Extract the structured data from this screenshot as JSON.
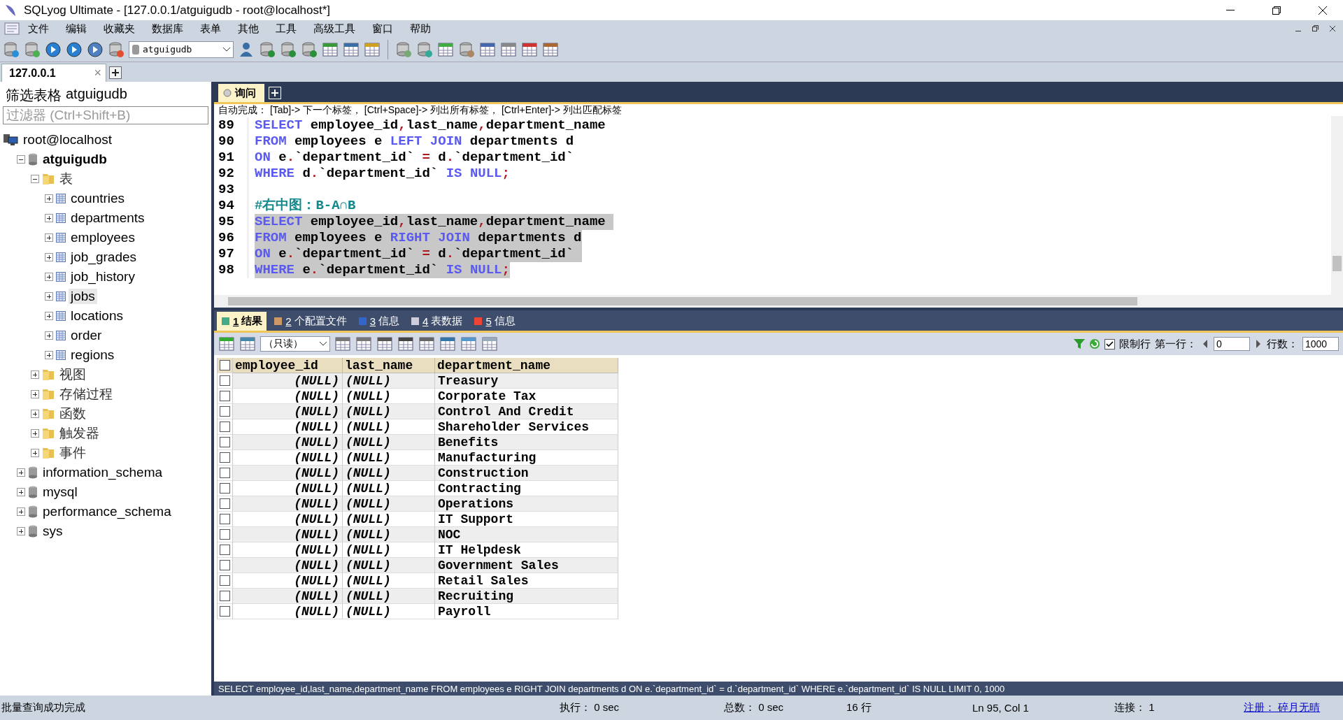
{
  "window": {
    "title": "SQLyog Ultimate - [127.0.0.1/atguigudb - root@localhost*]"
  },
  "menu": [
    "文件",
    "编辑",
    "收藏夹",
    "数据库",
    "表单",
    "其他",
    "工具",
    "高级工具",
    "窗口",
    "帮助"
  ],
  "toolbar": {
    "database_select": "atguigudb"
  },
  "connection_tabs": [
    {
      "label": "127.0.0.1",
      "selected": true,
      "close": "×"
    }
  ],
  "sidebar": {
    "title_prefix": "筛选表格",
    "title_db": "atguigudb",
    "filter": {
      "placeholder": "过滤器 (Ctrl+Shift+B)"
    },
    "tree": [
      {
        "label": "root@localhost",
        "kind": "server",
        "selected": false,
        "children": [
          {
            "label": "atguigudb",
            "kind": "database",
            "bold": true,
            "expanded": true,
            "selected": false,
            "children": [
              {
                "label": "表",
                "kind": "folder",
                "expanded": true,
                "selected": false,
                "children": [
                  {
                    "label": "countries",
                    "kind": "table",
                    "expanded": false,
                    "selected": false
                  },
                  {
                    "label": "departments",
                    "kind": "table",
                    "expanded": false,
                    "selected": false
                  },
                  {
                    "label": "employees",
                    "kind": "table",
                    "expanded": false,
                    "selected": false
                  },
                  {
                    "label": "job_grades",
                    "kind": "table",
                    "expanded": false,
                    "selected": false
                  },
                  {
                    "label": "job_history",
                    "kind": "table",
                    "expanded": false,
                    "selected": false
                  },
                  {
                    "label": "jobs",
                    "kind": "table",
                    "expanded": false,
                    "selected": true
                  },
                  {
                    "label": "locations",
                    "kind": "table",
                    "expanded": false,
                    "selected": false
                  },
                  {
                    "label": "order",
                    "kind": "table",
                    "expanded": false,
                    "selected": false
                  },
                  {
                    "label": "regions",
                    "kind": "table",
                    "expanded": false,
                    "selected": false
                  }
                ]
              },
              {
                "label": "视图",
                "kind": "folder",
                "expanded": false,
                "selected": false
              },
              {
                "label": "存储过程",
                "kind": "folder",
                "expanded": false,
                "selected": false
              },
              {
                "label": "函数",
                "kind": "folder",
                "expanded": false,
                "selected": false
              },
              {
                "label": "触发器",
                "kind": "folder",
                "expanded": false,
                "selected": false
              },
              {
                "label": "事件",
                "kind": "folder",
                "expanded": false,
                "selected": false
              }
            ]
          },
          {
            "label": "information_schema",
            "kind": "database",
            "expanded": false,
            "selected": false
          },
          {
            "label": "mysql",
            "kind": "database",
            "expanded": false,
            "selected": false
          },
          {
            "label": "performance_schema",
            "kind": "database",
            "expanded": false,
            "selected": false
          },
          {
            "label": "sys",
            "kind": "database",
            "expanded": false,
            "selected": false
          }
        ]
      }
    ]
  },
  "query_tabs": [
    {
      "label": "询问",
      "selected": true
    }
  ],
  "editor": {
    "hint": "自动完成： [Tab]-> 下一个标签， [Ctrl+Space]-> 列出所有标签， [Ctrl+Enter]-> 列出匹配标签",
    "lines": [
      {
        "number": "89",
        "highlighted": false,
        "tokens": [
          {
            "kind": "keyword",
            "text": "SELECT"
          },
          {
            "kind": "text",
            "text": " employee_id"
          },
          {
            "kind": "punct",
            "text": ","
          },
          {
            "kind": "text",
            "text": "last_name"
          },
          {
            "kind": "punct",
            "text": ","
          },
          {
            "kind": "text",
            "text": "department_name"
          }
        ]
      },
      {
        "number": "90",
        "highlighted": false,
        "tokens": [
          {
            "kind": "keyword",
            "text": "FROM"
          },
          {
            "kind": "text",
            "text": " employees e "
          },
          {
            "kind": "keyword",
            "text": "LEFT JOIN"
          },
          {
            "kind": "text",
            "text": " departments d"
          }
        ]
      },
      {
        "number": "91",
        "highlighted": false,
        "tokens": [
          {
            "kind": "keyword",
            "text": "ON"
          },
          {
            "kind": "text",
            "text": " e"
          },
          {
            "kind": "punct",
            "text": "."
          },
          {
            "kind": "text",
            "text": "`department_id` "
          },
          {
            "kind": "punct",
            "text": "="
          },
          {
            "kind": "text",
            "text": " d"
          },
          {
            "kind": "punct",
            "text": "."
          },
          {
            "kind": "text",
            "text": "`department_id`"
          }
        ]
      },
      {
        "number": "92",
        "highlighted": false,
        "tokens": [
          {
            "kind": "keyword",
            "text": "WHERE"
          },
          {
            "kind": "text",
            "text": " d"
          },
          {
            "kind": "punct",
            "text": "."
          },
          {
            "kind": "text",
            "text": "`department_id` "
          },
          {
            "kind": "keyword",
            "text": "IS NULL"
          },
          {
            "kind": "punct",
            "text": ";"
          }
        ]
      },
      {
        "number": "93"
      },
      {
        "number": "94",
        "highlighted": false,
        "tokens": [
          {
            "kind": "comment",
            "text": "#右中图：B-A∩B"
          }
        ]
      },
      {
        "number": "95",
        "highlighted": true,
        "tokens": [
          {
            "kind": "keyword",
            "text": "SELECT"
          },
          {
            "kind": "text",
            "text": " employee_id"
          },
          {
            "kind": "punct",
            "text": ","
          },
          {
            "kind": "text",
            "text": "last_name"
          },
          {
            "kind": "punct",
            "text": ","
          },
          {
            "kind": "text",
            "text": "department_name "
          }
        ]
      },
      {
        "number": "96",
        "highlighted": true,
        "tokens": [
          {
            "kind": "keyword",
            "text": "FROM"
          },
          {
            "kind": "text",
            "text": " employees e "
          },
          {
            "kind": "keyword",
            "text": "RIGHT JOIN"
          },
          {
            "kind": "text",
            "text": " departments d"
          }
        ]
      },
      {
        "number": "97",
        "highlighted": true,
        "tokens": [
          {
            "kind": "keyword",
            "text": "ON"
          },
          {
            "kind": "text",
            "text": " e"
          },
          {
            "kind": "punct",
            "text": "."
          },
          {
            "kind": "text",
            "text": "`department_id` "
          },
          {
            "kind": "punct",
            "text": "="
          },
          {
            "kind": "text",
            "text": " d"
          },
          {
            "kind": "punct",
            "text": "."
          },
          {
            "kind": "text",
            "text": "`department_id` "
          }
        ]
      },
      {
        "number": "98",
        "highlighted": true,
        "tokens": [
          {
            "kind": "keyword",
            "text": "WHERE"
          },
          {
            "kind": "text",
            "text": " e"
          },
          {
            "kind": "punct",
            "text": "."
          },
          {
            "kind": "text",
            "text": "`department_id` "
          },
          {
            "kind": "keyword",
            "text": "IS NULL"
          },
          {
            "kind": "punct",
            "text": ";"
          }
        ]
      }
    ]
  },
  "result_tabs": [
    {
      "number": "1",
      "label": "结果",
      "selected": true
    },
    {
      "number": "2",
      "label": "个配置文件",
      "selected": false
    },
    {
      "number": "3",
      "label": "信息",
      "selected": false
    },
    {
      "number": "4",
      "label": "表数据",
      "selected": false
    },
    {
      "number": "5",
      "label": "信息",
      "selected": false
    }
  ],
  "result_toolbar": {
    "mode": "（只读）",
    "limit_rows": {
      "label": "限制行",
      "checked": true
    },
    "first_row_label": "第一行：",
    "first_row": "0",
    "row_count_label": "行数：",
    "row_count": "1000"
  },
  "table": {
    "all_selected": false,
    "columns": [
      "employee_id",
      "last_name",
      "department_name"
    ],
    "rows": [
      {
        "checked": false,
        "cells": [
          "(NULL)",
          "(NULL)",
          "Treasury"
        ]
      },
      {
        "checked": false,
        "cells": [
          "(NULL)",
          "(NULL)",
          "Corporate Tax"
        ]
      },
      {
        "checked": false,
        "cells": [
          "(NULL)",
          "(NULL)",
          "Control And Credit"
        ]
      },
      {
        "checked": false,
        "cells": [
          "(NULL)",
          "(NULL)",
          "Shareholder Services"
        ]
      },
      {
        "checked": false,
        "cells": [
          "(NULL)",
          "(NULL)",
          "Benefits"
        ]
      },
      {
        "checked": false,
        "cells": [
          "(NULL)",
          "(NULL)",
          "Manufacturing"
        ]
      },
      {
        "checked": false,
        "cells": [
          "(NULL)",
          "(NULL)",
          "Construction"
        ]
      },
      {
        "checked": false,
        "cells": [
          "(NULL)",
          "(NULL)",
          "Contracting"
        ]
      },
      {
        "checked": false,
        "cells": [
          "(NULL)",
          "(NULL)",
          "Operations"
        ]
      },
      {
        "checked": false,
        "cells": [
          "(NULL)",
          "(NULL)",
          "IT Support"
        ]
      },
      {
        "checked": false,
        "cells": [
          "(NULL)",
          "(NULL)",
          "NOC"
        ]
      },
      {
        "checked": false,
        "cells": [
          "(NULL)",
          "(NULL)",
          "IT Helpdesk"
        ]
      },
      {
        "checked": false,
        "cells": [
          "(NULL)",
          "(NULL)",
          "Government Sales"
        ]
      },
      {
        "checked": false,
        "cells": [
          "(NULL)",
          "(NULL)",
          "Retail Sales"
        ]
      },
      {
        "checked": false,
        "cells": [
          "(NULL)",
          "(NULL)",
          "Recruiting"
        ]
      },
      {
        "checked": false,
        "cells": [
          "(NULL)",
          "(NULL)",
          "Payroll"
        ]
      }
    ]
  },
  "sql_bar": "SELECT employee_id,last_name,department_name FROM employees e RIGHT JOIN departments d ON e.`department_id` = d.`department_id` WHERE e.`department_id` IS NULL LIMIT 0, 1000",
  "status_bar": {
    "message": "批量查询成功完成",
    "exec": "执行： 0 sec",
    "total": "总数： 0 sec",
    "rows": "16 行",
    "position": "Ln 95, Col 1",
    "connections": "连接： 1",
    "register": "注册： 碎月无晴"
  }
}
